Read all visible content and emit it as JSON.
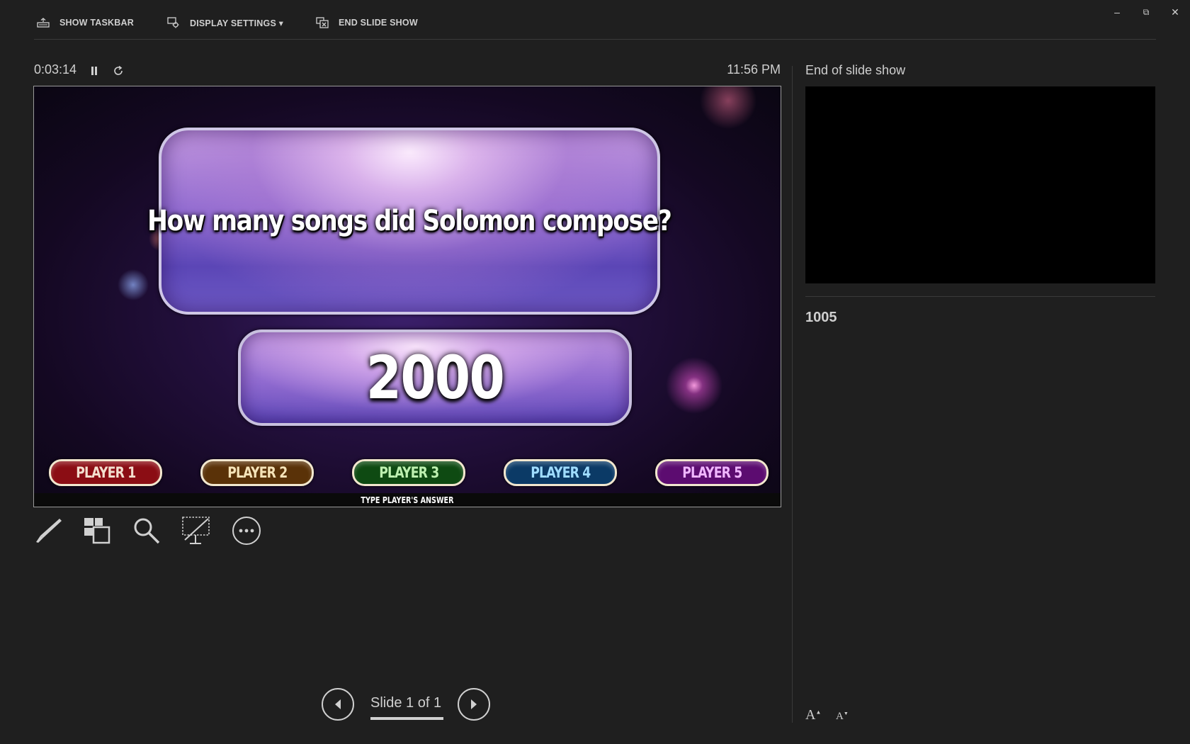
{
  "toolbar": {
    "show_taskbar": "SHOW TASKBAR",
    "display_settings": "DISPLAY SETTINGS ▾",
    "end_slide_show": "END SLIDE SHOW"
  },
  "window_controls": {
    "minimize": "–",
    "restore": "⧉",
    "close": "✕"
  },
  "timer": {
    "elapsed": "0:03:14",
    "clock": "11:56 PM"
  },
  "slide": {
    "question": "How many songs did Solomon compose?",
    "answer": "2000",
    "players": [
      {
        "label": "PLAYER 1",
        "color": "#8b0d14",
        "text_color": "#f3dfcf"
      },
      {
        "label": "PLAYER 2",
        "color": "#5a3208",
        "text_color": "#f5e3b8"
      },
      {
        "label": "PLAYER 3",
        "color": "#0e4a12",
        "text_color": "#bdf0b0"
      },
      {
        "label": "PLAYER 4",
        "color": "#0b3a66",
        "text_color": "#9fdcff"
      },
      {
        "label": "PLAYER 5",
        "color": "#5c0c70",
        "text_color": "#f0b6ff"
      }
    ],
    "footer": "TYPE PLAYER'S ANSWER"
  },
  "tools": [
    "pen-icon",
    "slides-grid-icon",
    "zoom-icon",
    "black-screen-icon",
    "more-icon"
  ],
  "navigation": {
    "slide_counter": "Slide 1 of 1"
  },
  "next_slide": {
    "label": "End of slide show"
  },
  "notes": {
    "text": "1005"
  },
  "notes_font": {
    "increase": "A",
    "decrease": "A"
  }
}
